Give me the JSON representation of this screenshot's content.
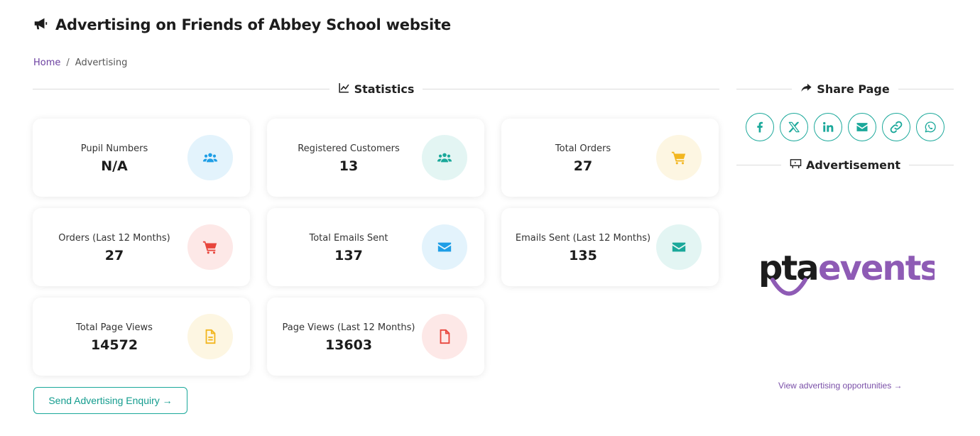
{
  "page": {
    "title": "Advertising on Friends of Abbey School website"
  },
  "breadcrumb": {
    "home": "Home",
    "separator": "/",
    "current": "Advertising"
  },
  "sections": {
    "statistics": "Statistics",
    "share": "Share Page",
    "advertisement": "Advertisement"
  },
  "stats": [
    {
      "label": "Pupil Numbers",
      "value": "N/A",
      "icon": "users-icon",
      "color": "#1e9ee6",
      "bg": "#e3f3fc"
    },
    {
      "label": "Registered Customers",
      "value": "13",
      "icon": "users-icon",
      "color": "#1aa89a",
      "bg": "#e3f5f3"
    },
    {
      "label": "Total Orders",
      "value": "27",
      "icon": "cart-icon",
      "color": "#f2b620",
      "bg": "#fdf6e2"
    },
    {
      "label": "Orders (Last 12 Months)",
      "value": "27",
      "icon": "cart-icon",
      "color": "#e8453c",
      "bg": "#fde8e7"
    },
    {
      "label": "Total Emails Sent",
      "value": "137",
      "icon": "envelope-icon",
      "color": "#1e9ee6",
      "bg": "#e3f3fc"
    },
    {
      "label": "Emails Sent (Last 12 Months)",
      "value": "135",
      "icon": "envelope-icon",
      "color": "#1aa89a",
      "bg": "#e3f5f3"
    },
    {
      "label": "Total Page Views",
      "value": "14572",
      "icon": "file-icon",
      "color": "#f2b620",
      "bg": "#fdf6e2"
    },
    {
      "label": "Page Views (Last 12 Months)",
      "value": "13603",
      "icon": "file-icon",
      "color": "#e8453c",
      "bg": "#fde8e7"
    }
  ],
  "buttons": {
    "enquiry": "Send Advertising Enquiry →"
  },
  "share_icons": [
    "facebook-icon",
    "x-icon",
    "linkedin-icon",
    "email-icon",
    "link-icon",
    "whatsapp-icon"
  ],
  "ad": {
    "logo_text_dark": "pta",
    "logo_text_accent": "events",
    "link": "View advertising opportunities →"
  },
  "colors": {
    "accent_teal": "#1aa89a",
    "brand_purple": "#7a4fa8"
  }
}
